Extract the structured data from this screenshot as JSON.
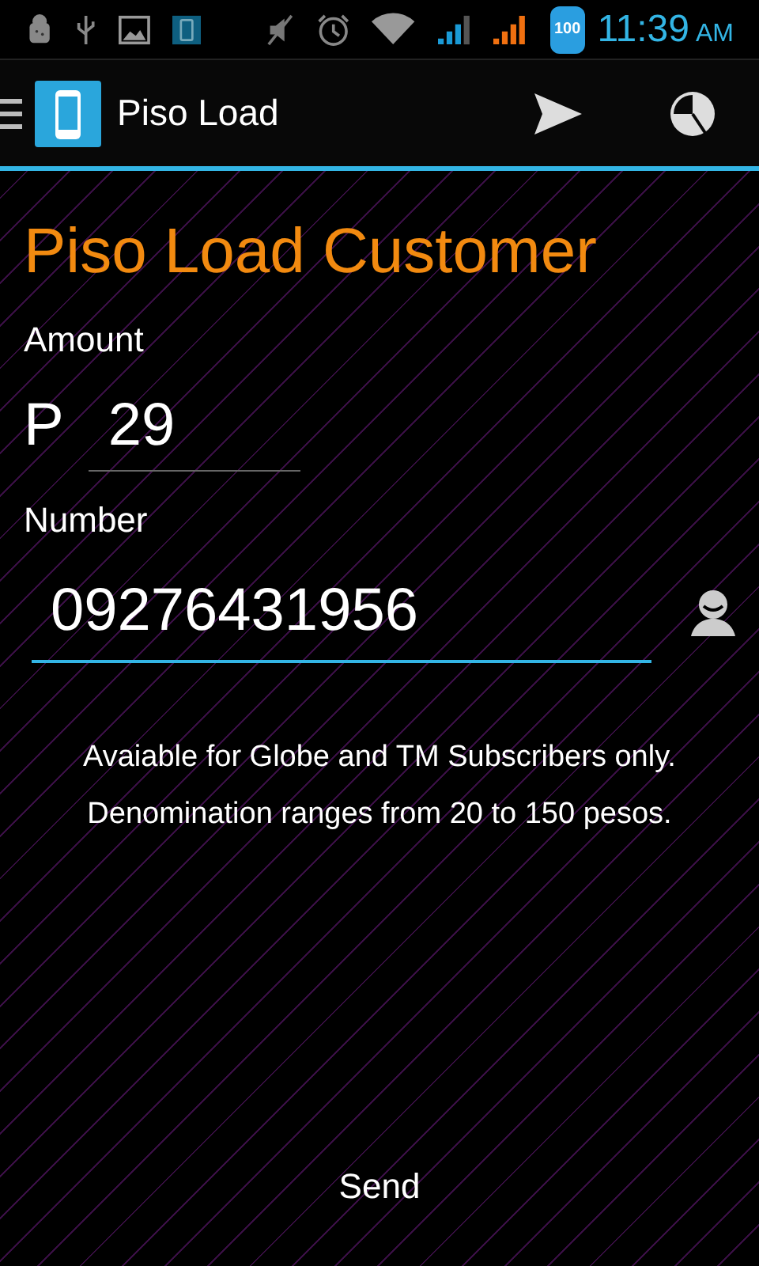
{
  "status_bar": {
    "battery_label": "100",
    "time": "11:39",
    "meridiem": "AM"
  },
  "action_bar": {
    "title": "Piso Load"
  },
  "heading": "Piso Load Customer",
  "fields": [
    {
      "label": "Amount",
      "prefix": "P",
      "value": "29",
      "focused": false
    },
    {
      "label": "Number",
      "value": "09276431956",
      "focused": true
    }
  ],
  "info": [
    "Avaiable for Globe and TM Subscribers only.",
    "Denomination ranges from 20 to 150 pesos."
  ],
  "send_button": "Send"
}
